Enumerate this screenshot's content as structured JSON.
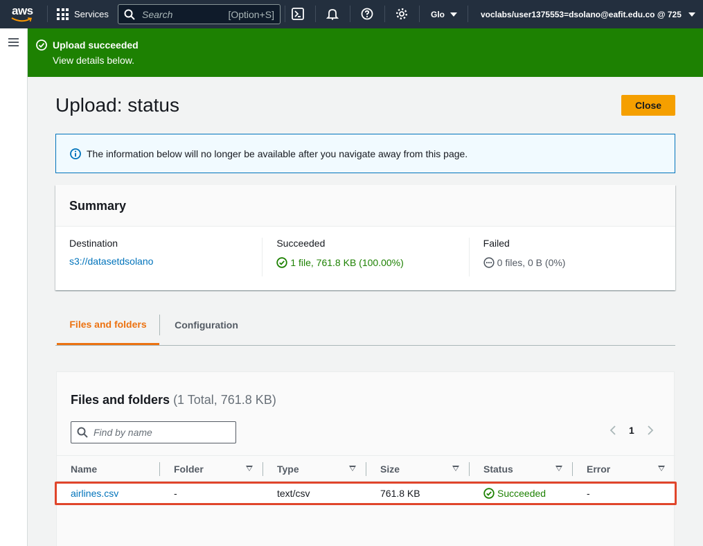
{
  "nav": {
    "logo": "aws",
    "services": "Services",
    "search_placeholder": "Search",
    "search_shortcut": "[Option+S]",
    "region": "Glo",
    "account": "voclabs/user1375553=dsolano@eafit.edu.co @ 725"
  },
  "flash": {
    "title": "Upload succeeded",
    "message": "View details below.",
    "color": "#1d8102"
  },
  "page": {
    "title": "Upload: status",
    "close_label": "Close"
  },
  "info": {
    "text": "The information below will no longer be available after you navigate away from this page."
  },
  "summary": {
    "title": "Summary",
    "destination_label": "Destination",
    "destination_value": "s3://datasetdsolano",
    "succeeded_label": "Succeeded",
    "succeeded_value": "1 file, 761.8 KB (100.00%)",
    "failed_label": "Failed",
    "failed_value": "0 files, 0 B (0%)"
  },
  "tabs": [
    {
      "label": "Files and folders",
      "active": true
    },
    {
      "label": "Configuration",
      "active": false
    }
  ],
  "files": {
    "title": "Files and folders",
    "count": "(1 Total, 761.8 KB)",
    "find_placeholder": "Find by name",
    "page": "1",
    "columns": [
      "Name",
      "Folder",
      "Type",
      "Size",
      "Status",
      "Error"
    ],
    "rows": [
      {
        "name": "airlines.csv",
        "folder": "-",
        "type": "text/csv",
        "size": "761.8 KB",
        "status": "Succeeded",
        "error": "-"
      }
    ]
  },
  "colors": {
    "accent": "#ec7211",
    "link": "#0073bb",
    "success": "#1d8102",
    "highlight": "#e0452b"
  }
}
